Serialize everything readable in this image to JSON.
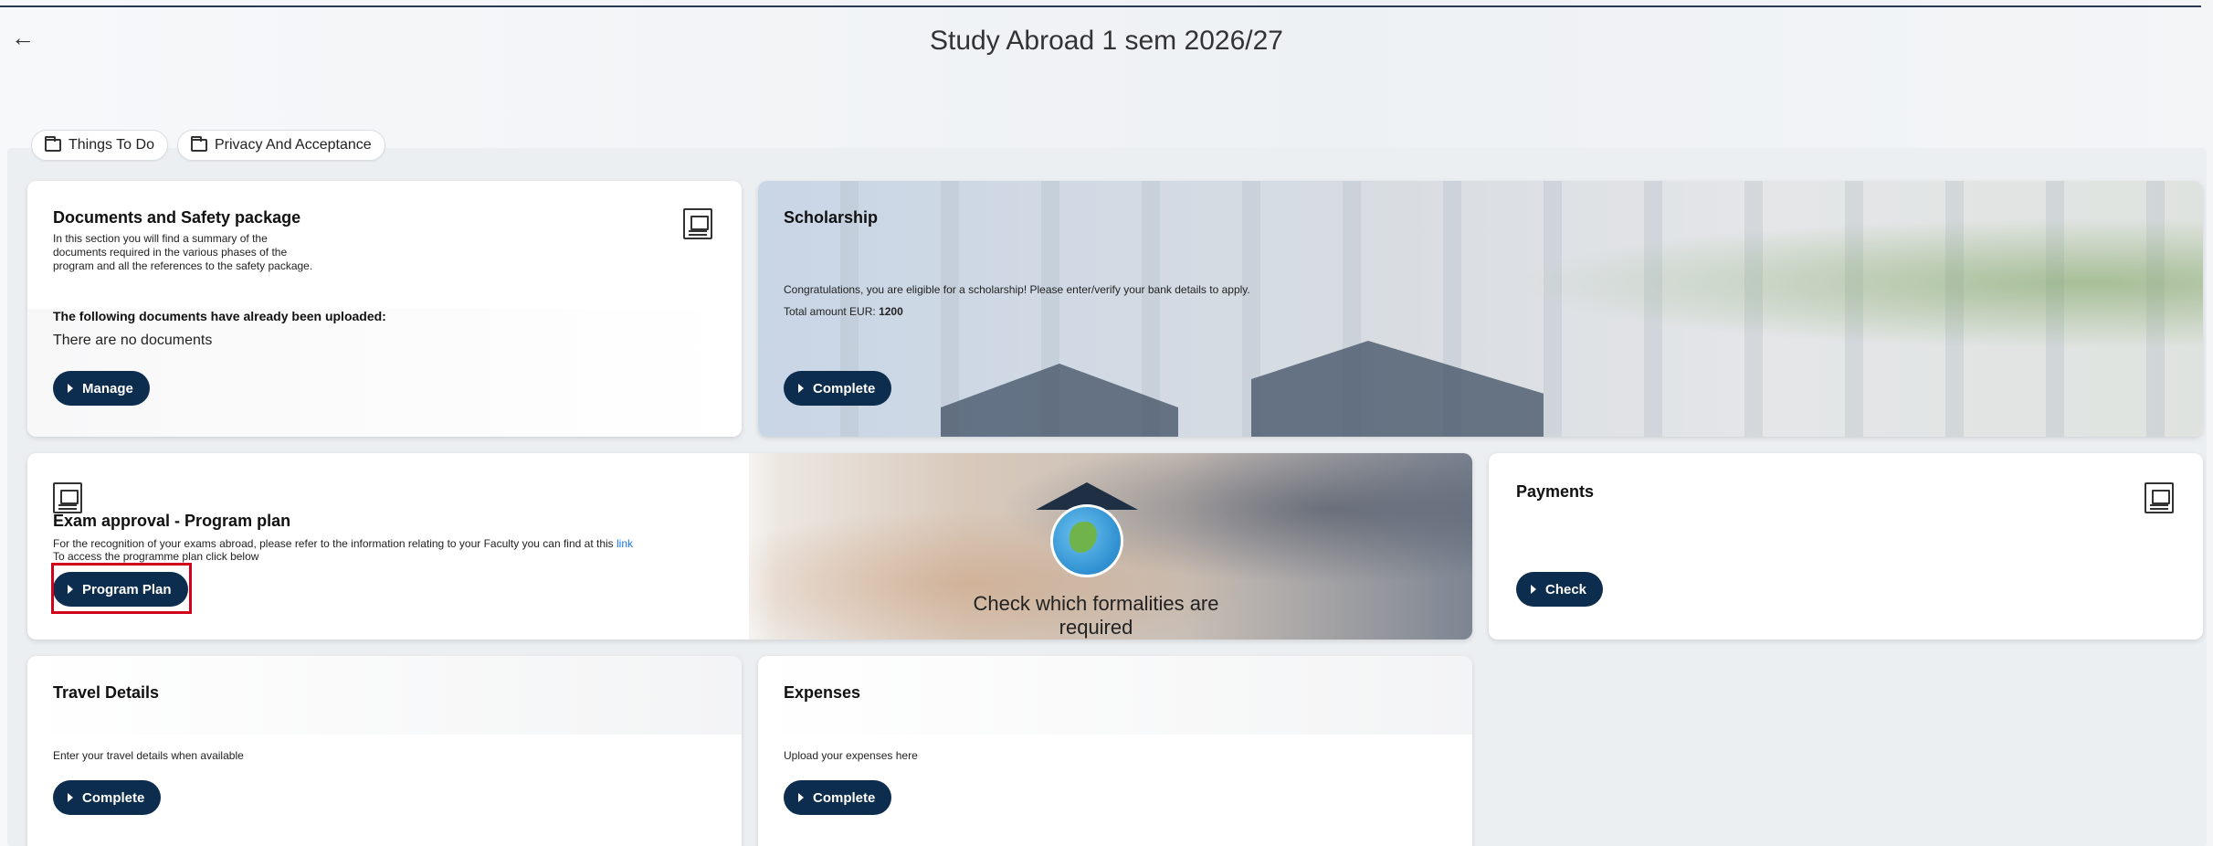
{
  "header": {
    "title": "Study Abroad 1 sem 2026/27",
    "back_icon": "←"
  },
  "tabs": [
    {
      "label": "Things To Do"
    },
    {
      "label": "Privacy And Acceptance"
    }
  ],
  "cards": {
    "documents": {
      "title": "Documents and Safety package",
      "description": "In this section you will find a summary of the documents required in the various phases of the program and all the references to the safety package.",
      "uploaded_heading": "The following documents have already been uploaded:",
      "uploaded_value": "There are no documents",
      "button": "Manage"
    },
    "scholarship": {
      "title": "Scholarship",
      "message": "Congratulations, you are eligible for a scholarship! Please enter/verify your bank details to apply.",
      "amount_label": "Total amount EUR:",
      "amount_value": "1200",
      "button": "Complete"
    },
    "exam": {
      "title": "Exam approval - Program plan",
      "description": "For the recognition of your exams abroad, please refer to the information relating to your Faculty you can find at this",
      "link": "link",
      "description2": "To access the programme plan click below",
      "button": "Program Plan",
      "banner_text": "Check which formalities are required"
    },
    "payments": {
      "title": "Payments",
      "button": "Check"
    },
    "travel": {
      "title": "Travel Details",
      "description": "Enter your travel details when available",
      "button": "Complete"
    },
    "expenses": {
      "title": "Expenses",
      "description": "Upload your expenses here",
      "button": "Complete"
    }
  },
  "colors": {
    "button_bg": "#0d2d4f",
    "highlight": "#d0021b",
    "link": "#1a73e8"
  }
}
